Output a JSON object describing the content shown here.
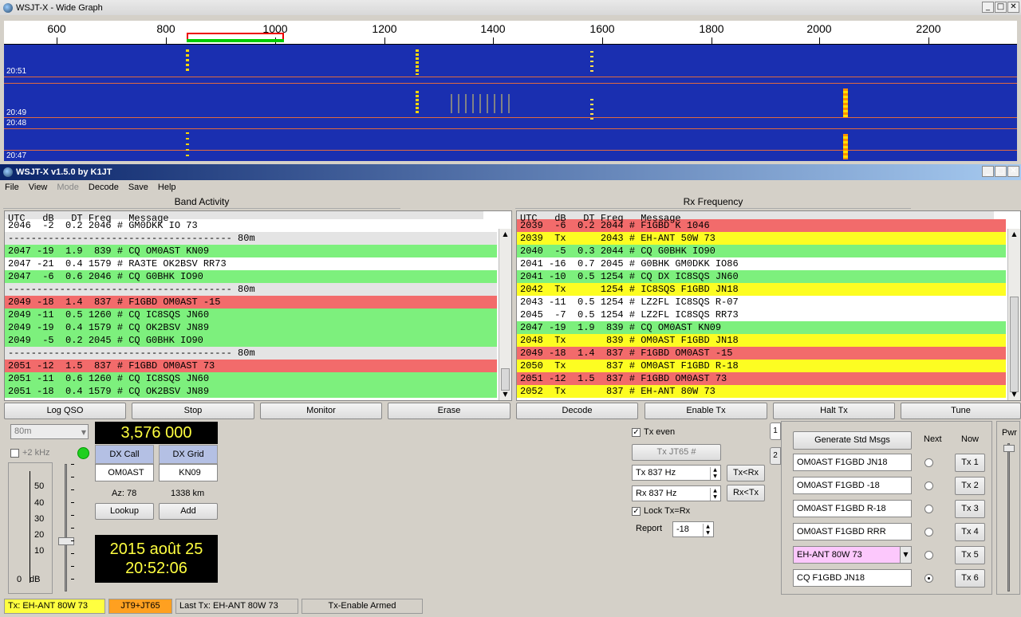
{
  "wide_graph": {
    "title": "WSJT-X - Wide Graph",
    "scale_labels": [
      "600",
      "800",
      "1000",
      "1200",
      "1400",
      "1600",
      "1800",
      "2000",
      "2200"
    ],
    "times": [
      "20:51",
      "20:49",
      "20:48",
      "20:47"
    ]
  },
  "main": {
    "title": "WSJT-X  v1.5.0  by K1JT",
    "menu": [
      "File",
      "View",
      "Mode",
      "Decode",
      "Save",
      "Help"
    ],
    "band_activity": {
      "title": "Band Activity",
      "header": "UTC   dB   DT Freq   Message",
      "rows": [
        {
          "t": "2046  -2  0.2 2046 # GM0DKK IO 73",
          "c": "w"
        },
        {
          "t": "--------------------------------------- 80m",
          "c": "sep"
        },
        {
          "t": "2047 -19  1.9  839 # CQ OM0AST KN09",
          "c": "g"
        },
        {
          "t": "2047 -21  0.4 1579 # RA3TE OK2BSV RR73",
          "c": "w"
        },
        {
          "t": "2047  -6  0.6 2046 # CQ G0BHK IO90",
          "c": "g"
        },
        {
          "t": "--------------------------------------- 80m",
          "c": "sep"
        },
        {
          "t": "2049 -18  1.4  837 # F1GBD OM0AST -15",
          "c": "r"
        },
        {
          "t": "2049 -11  0.5 1260 # CQ IC8SQS JN60",
          "c": "g"
        },
        {
          "t": "2049 -19  0.4 1579 # CQ OK2BSV JN89",
          "c": "g"
        },
        {
          "t": "2049  -5  0.2 2045 # CQ G0BHK IO90",
          "c": "g"
        },
        {
          "t": "--------------------------------------- 80m",
          "c": "sep"
        },
        {
          "t": "2051 -12  1.5  837 # F1GBD OM0AST 73",
          "c": "r"
        },
        {
          "t": "2051 -11  0.6 1260 # CQ IC8SQS JN60",
          "c": "g"
        },
        {
          "t": "2051 -18  0.4 1579 # CQ OK2BSV JN89",
          "c": "g"
        }
      ]
    },
    "rx_frequency": {
      "title": "Rx Frequency",
      "header": "UTC   dB   DT Freq   Message",
      "rows": [
        {
          "t": "2039  -6  0.2 2044 # F1GBD K 1046",
          "c": "r"
        },
        {
          "t": "2039  Tx      2043 # EH-ANT 50W 73",
          "c": "y"
        },
        {
          "t": "2040  -5  0.3 2044 # CQ G0BHK IO90",
          "c": "g"
        },
        {
          "t": "2041 -16  0.7 2045 # G0BHK GM0DKK IO86",
          "c": "w"
        },
        {
          "t": "2041 -10  0.5 1254 # CQ DX IC8SQS JN60",
          "c": "g"
        },
        {
          "t": "2042  Tx      1254 # IC8SQS F1GBD JN18",
          "c": "y"
        },
        {
          "t": "2043 -11  0.5 1254 # LZ2FL IC8SQS R-07",
          "c": "w"
        },
        {
          "t": "2045  -7  0.5 1254 # LZ2FL IC8SQS RR73",
          "c": "w"
        },
        {
          "t": "2047 -19  1.9  839 # CQ OM0AST KN09",
          "c": "g"
        },
        {
          "t": "2048  Tx       839 # OM0AST F1GBD JN18",
          "c": "y"
        },
        {
          "t": "2049 -18  1.4  837 # F1GBD OM0AST -15",
          "c": "r"
        },
        {
          "t": "2050  Tx       837 # OM0AST F1GBD R-18",
          "c": "y"
        },
        {
          "t": "2051 -12  1.5  837 # F1GBD OM0AST 73",
          "c": "r"
        },
        {
          "t": "2052  Tx       837 # EH-ANT 80W 73",
          "c": "y"
        }
      ]
    },
    "buttons": {
      "log_qso": "Log QSO",
      "stop": "Stop",
      "monitor": "Monitor",
      "erase": "Erase",
      "decode": "Decode",
      "enable_tx": "Enable Tx",
      "halt_tx": "Halt Tx",
      "tune": "Tune",
      "lookup": "Lookup",
      "add": "Add",
      "gen_std": "Generate Std Msgs",
      "tx_mode": "Tx JT65  #",
      "tx_lt_rx": "Tx<Rx",
      "rx_lt_tx": "Rx<Tx"
    },
    "band": "80m",
    "plus2k": "+2 kHz",
    "frequency": "3,576 000",
    "dx_call_label": "DX Call",
    "dx_grid_label": "DX Grid",
    "dx_call": "OM0AST",
    "dx_grid": "KN09",
    "az": "Az: 78",
    "km": "1338 km",
    "date": "2015 août 25",
    "time": "20:52:06",
    "meter_labels": [
      "50",
      "40",
      "30",
      "20",
      "10",
      "0"
    ],
    "db_label": "dB",
    "tx_even": "Tx even",
    "tx_hz": "Tx  837  Hz",
    "rx_hz": "Rx  837  Hz",
    "lock": "Lock Tx=Rx",
    "report_label": "Report",
    "report": "-18",
    "next_label": "Next",
    "now_label": "Now",
    "messages": [
      "OM0AST F1GBD JN18",
      "OM0AST F1GBD -18",
      "OM0AST F1GBD R-18",
      "OM0AST F1GBD RRR",
      "EH-ANT 80W 73",
      "CQ F1GBD JN18"
    ],
    "tx_buttons": [
      "Tx 1",
      "Tx 2",
      "Tx 3",
      "Tx 4",
      "Tx 5",
      "Tx 6"
    ],
    "tab1": "1",
    "tab2": "2",
    "pwr": "Pwr",
    "status": {
      "tx": "Tx: EH-ANT 80W 73",
      "mode": "JT9+JT65",
      "last": "Last Tx:  EH-ANT 80W 73",
      "armed": "Tx-Enable Armed"
    }
  }
}
